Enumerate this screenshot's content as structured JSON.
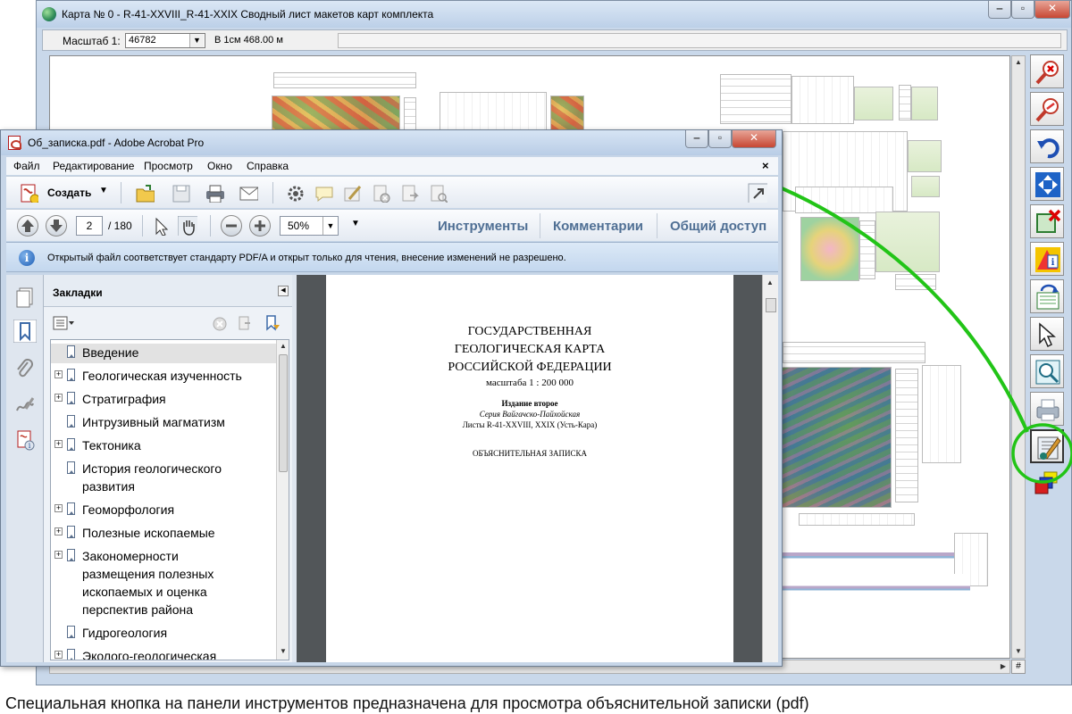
{
  "map_window": {
    "title": "Карта № 0 - R-41-XXVIII_R-41-XXIX  Сводный лист макетов карт комплекта",
    "scale_label": "Масштаб 1:",
    "scale_value": "46782",
    "scale_cm": "В 1см 468.00 м",
    "grid_button": "#",
    "tools": [
      "zoom-out-icon",
      "zoom-in-icon",
      "undo-icon",
      "fit-extent-icon",
      "remove-extent-icon",
      "info-icon",
      "refresh-layout-icon",
      "pointer-icon",
      "search-map-icon",
      "print-icon",
      "explanatory-note-icon",
      "layers-icon"
    ]
  },
  "acrobat": {
    "title": "Об_записка.pdf - Adobe Acrobat Pro",
    "menu": [
      "Файл",
      "Редактирование",
      "Просмотр",
      "Окно",
      "Справка"
    ],
    "menu_close": "×",
    "create_label": "Создать",
    "page_current": "2",
    "page_total": "/ 180",
    "zoom": "50%",
    "panels": [
      "Инструменты",
      "Комментарии",
      "Общий доступ"
    ],
    "info_message": "Открытый файл соответствует стандарту PDF/A и открыт только для чтения, внесение изменений не разрешено.",
    "bookmarks_title": "Закладки",
    "bookmarks": [
      {
        "label": "Введение",
        "expandable": false,
        "selected": true
      },
      {
        "label": "Геологическая изученность",
        "expandable": true
      },
      {
        "label": "Стратиграфия",
        "expandable": true
      },
      {
        "label": "Интрузивный магматизм",
        "expandable": false
      },
      {
        "label": "Тектоника",
        "expandable": true
      },
      {
        "label": "История геологического\nразвития",
        "expandable": false
      },
      {
        "label": "Геоморфология",
        "expandable": true
      },
      {
        "label": "Полезные ископаемые",
        "expandable": true
      },
      {
        "label": "Закономерности\nразмещения полезных\nископаемых и оценка\nперспектив района",
        "expandable": true
      },
      {
        "label": "Гидрогеология",
        "expandable": false
      },
      {
        "label": "Эколого-геологическая",
        "expandable": true
      }
    ],
    "document": {
      "title_lines": [
        "ГОСУДАРСТВЕННАЯ",
        "ГЕОЛОГИЧЕСКАЯ КАРТА",
        "РОССИЙСКОЙ ФЕДЕРАЦИИ"
      ],
      "scale": "масштаба 1 : 200 000",
      "edition": "Издание второе",
      "series": "Серия Вайгачско-Пайхойская",
      "sheets": "Листы R-41-XXVIII, XXIX (Усть-Кара)",
      "note_title": "ОБЪЯСНИТЕЛЬНАЯ ЗАПИСКА"
    }
  },
  "caption": "Специальная кнопка на панели инструментов предназначена для просмотра объяснительной записки (pdf)",
  "colors": {
    "highlight": "#22c417",
    "panel_link": "#4f6f94"
  }
}
